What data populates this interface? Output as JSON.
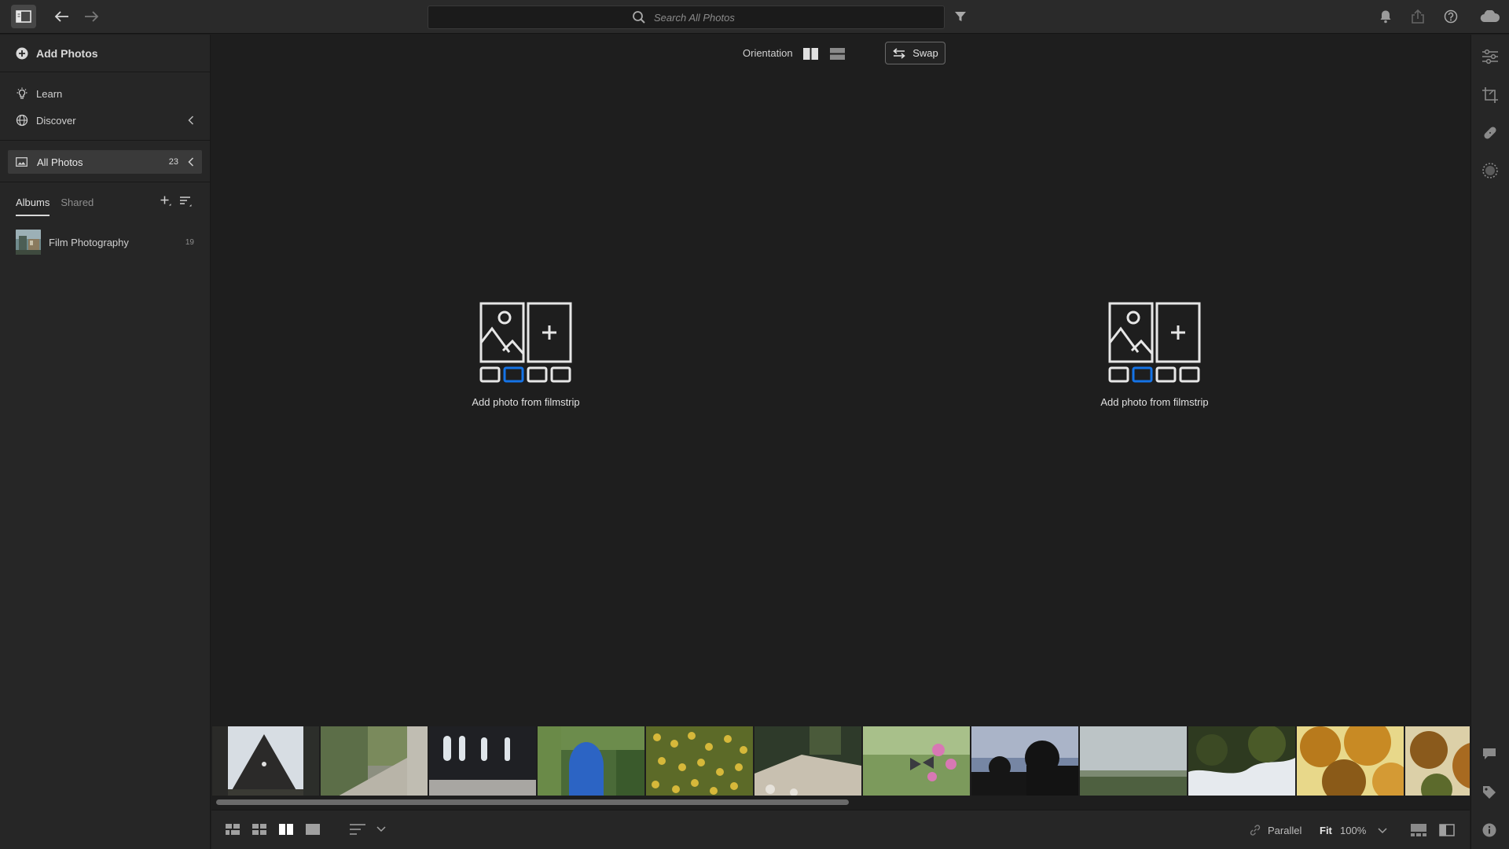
{
  "header": {
    "search_placeholder": "Search All Photos"
  },
  "sidebar": {
    "add_photos": "Add Photos",
    "nav": [
      {
        "label": "Learn",
        "icon": "lightbulb-icon"
      },
      {
        "label": "Discover",
        "icon": "globe-icon"
      }
    ],
    "all_photos": {
      "label": "All Photos",
      "count": "23"
    },
    "tabs": [
      {
        "label": "Albums",
        "active": true
      },
      {
        "label": "Shared",
        "active": false
      }
    ],
    "albums": [
      {
        "name": "Film Photography",
        "count": "19"
      }
    ]
  },
  "compare": {
    "orientation_label": "Orientation",
    "swap_label": "Swap",
    "left_slot_text": "Add photo from filmstrip",
    "right_slot_text": "Add photo from filmstrip",
    "accent_color": "#1473e6"
  },
  "filmstrip": {
    "thumbnails": [
      "church-gable",
      "stone-steps-ivy",
      "ruined-windows",
      "ivy-arch",
      "sunflower-field",
      "forest-path",
      "butterfly-flowers",
      "silhouettes-sunset",
      "overcast-landscape",
      "tree-canopy",
      "autumn-leaves",
      "autumn-branches"
    ]
  },
  "bottom": {
    "parallel_label": "Parallel",
    "fit_label": "Fit",
    "zoom_label": "100%"
  }
}
